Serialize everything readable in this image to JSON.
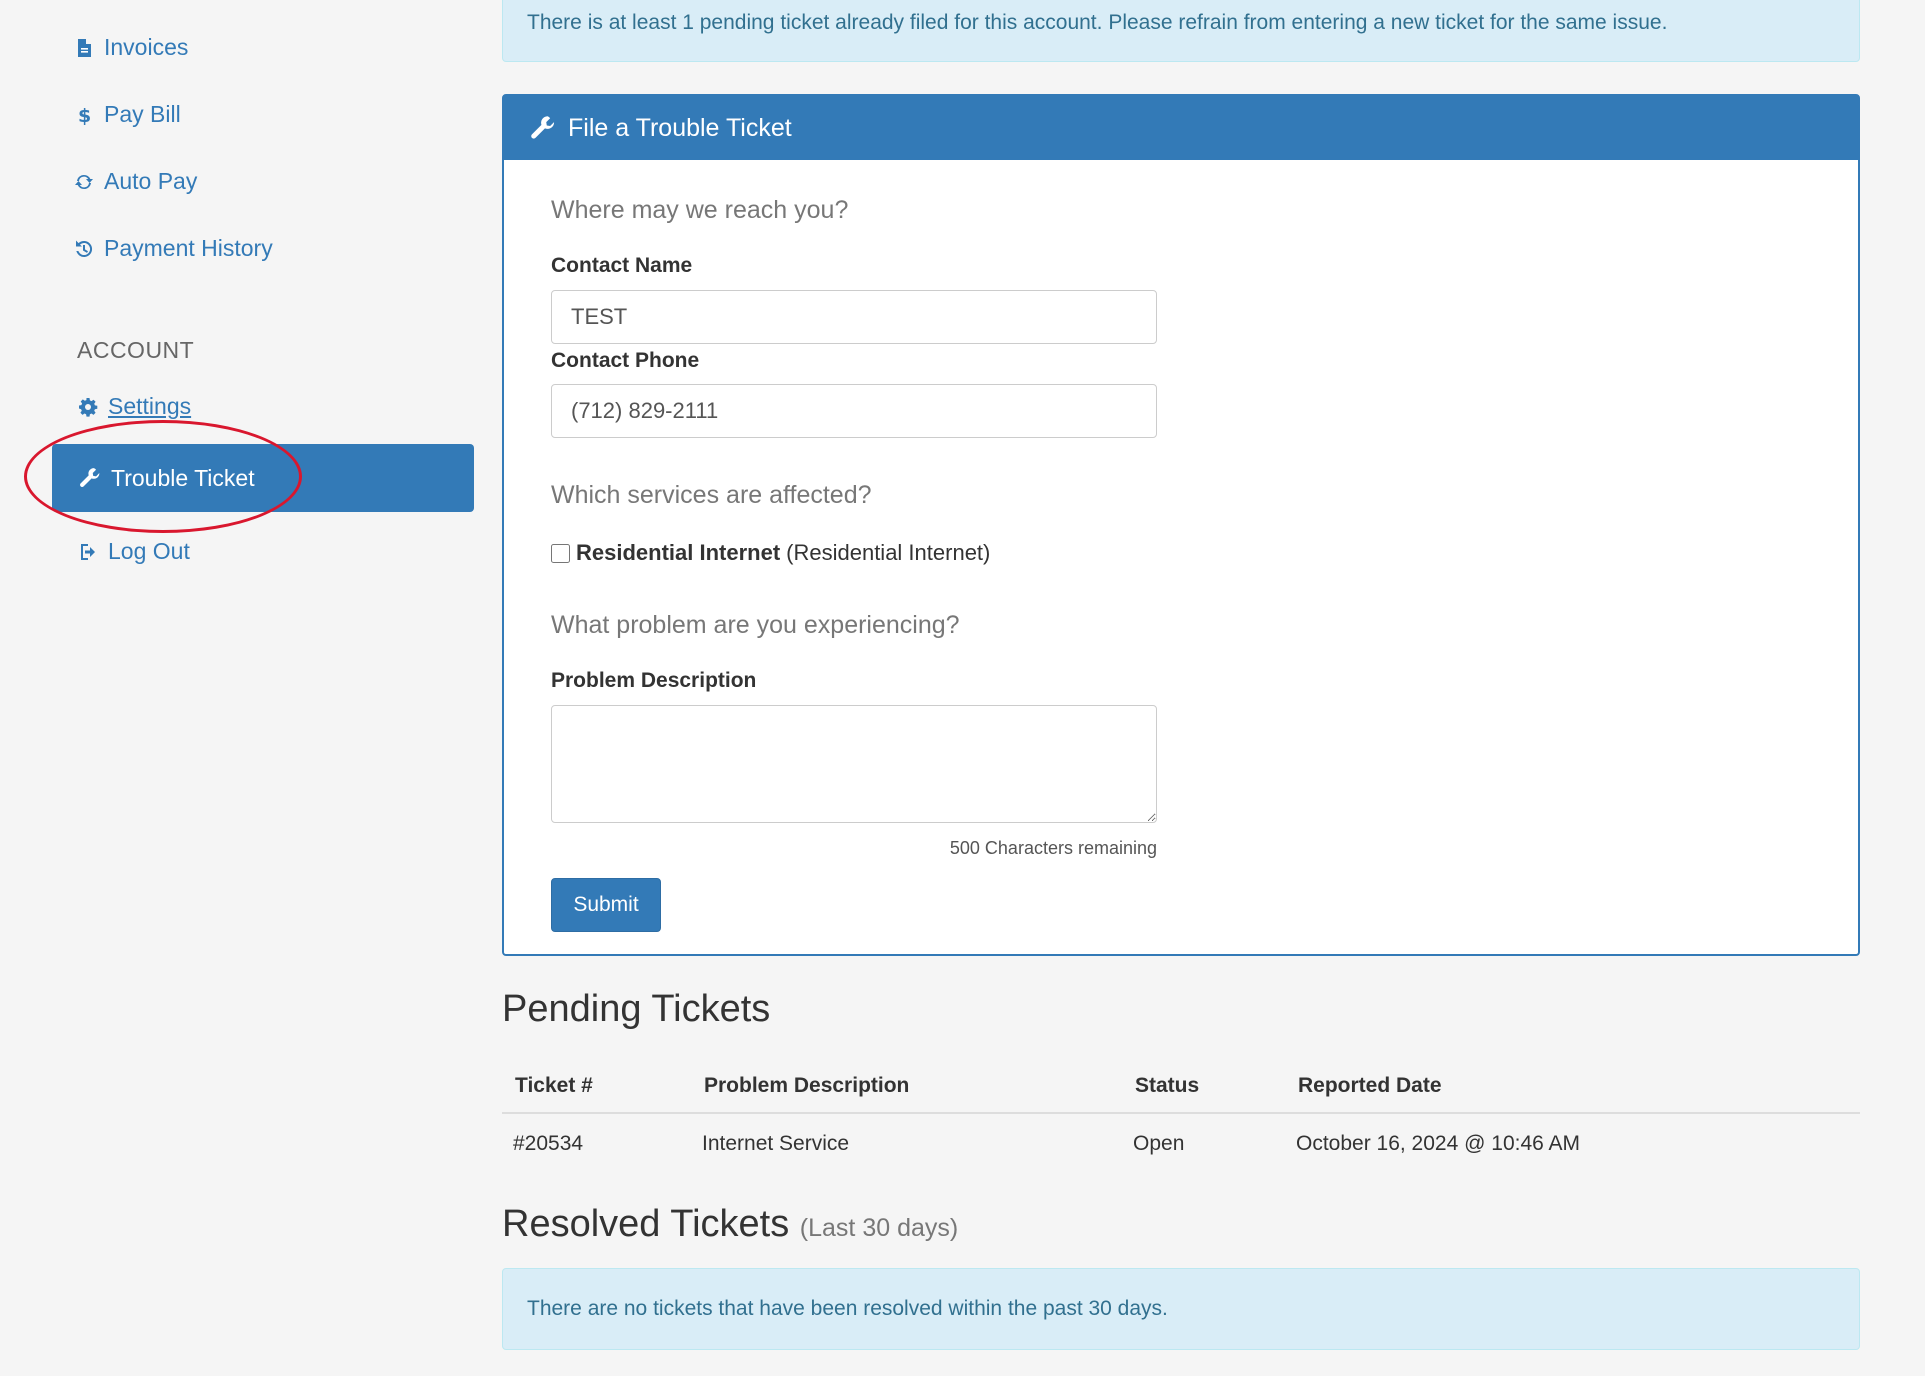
{
  "sidebar": {
    "invoices": "Invoices",
    "pay_bill": "Pay Bill",
    "auto_pay": "Auto Pay",
    "payment_history": "Payment History",
    "account_label": "ACCOUNT",
    "settings": "Settings",
    "trouble_ticket": "Trouble Ticket",
    "log_out": "Log Out"
  },
  "alerts": {
    "pending_notice": "There is at least 1 pending ticket already filed for this account. Please refrain from entering a new ticket for the same issue.",
    "no_resolved": "There are no tickets that have been resolved within the past 30 days."
  },
  "form": {
    "title": "File a Trouble Ticket",
    "reach_question": "Where may we reach you?",
    "contact_name_label": "Contact Name",
    "contact_name_value": "TEST",
    "contact_phone_label": "Contact Phone",
    "contact_phone_value": "(712) 829-2111",
    "services_question": "Which services are affected?",
    "service_name": "Residential Internet",
    "service_detail": "(Residential Internet)",
    "problem_question": "What problem are you experiencing?",
    "problem_label": "Problem Description",
    "problem_value": "",
    "chars_remaining": "500 Characters remaining",
    "submit_label": "Submit"
  },
  "pending": {
    "heading": "Pending Tickets",
    "columns": [
      "Ticket #",
      "Problem Description",
      "Status",
      "Reported Date"
    ],
    "rows": [
      {
        "ticket": "#20534",
        "problem": "Internet Service",
        "status": "Open",
        "date": "October 16, 2024 @ 10:46 AM"
      }
    ]
  },
  "resolved": {
    "heading": "Resolved Tickets",
    "subheading": "(Last 30 days)"
  },
  "colors": {
    "primary": "#337ab7",
    "alert_bg": "#d9edf7",
    "alert_text": "#31708f",
    "highlight": "#d9172e"
  }
}
